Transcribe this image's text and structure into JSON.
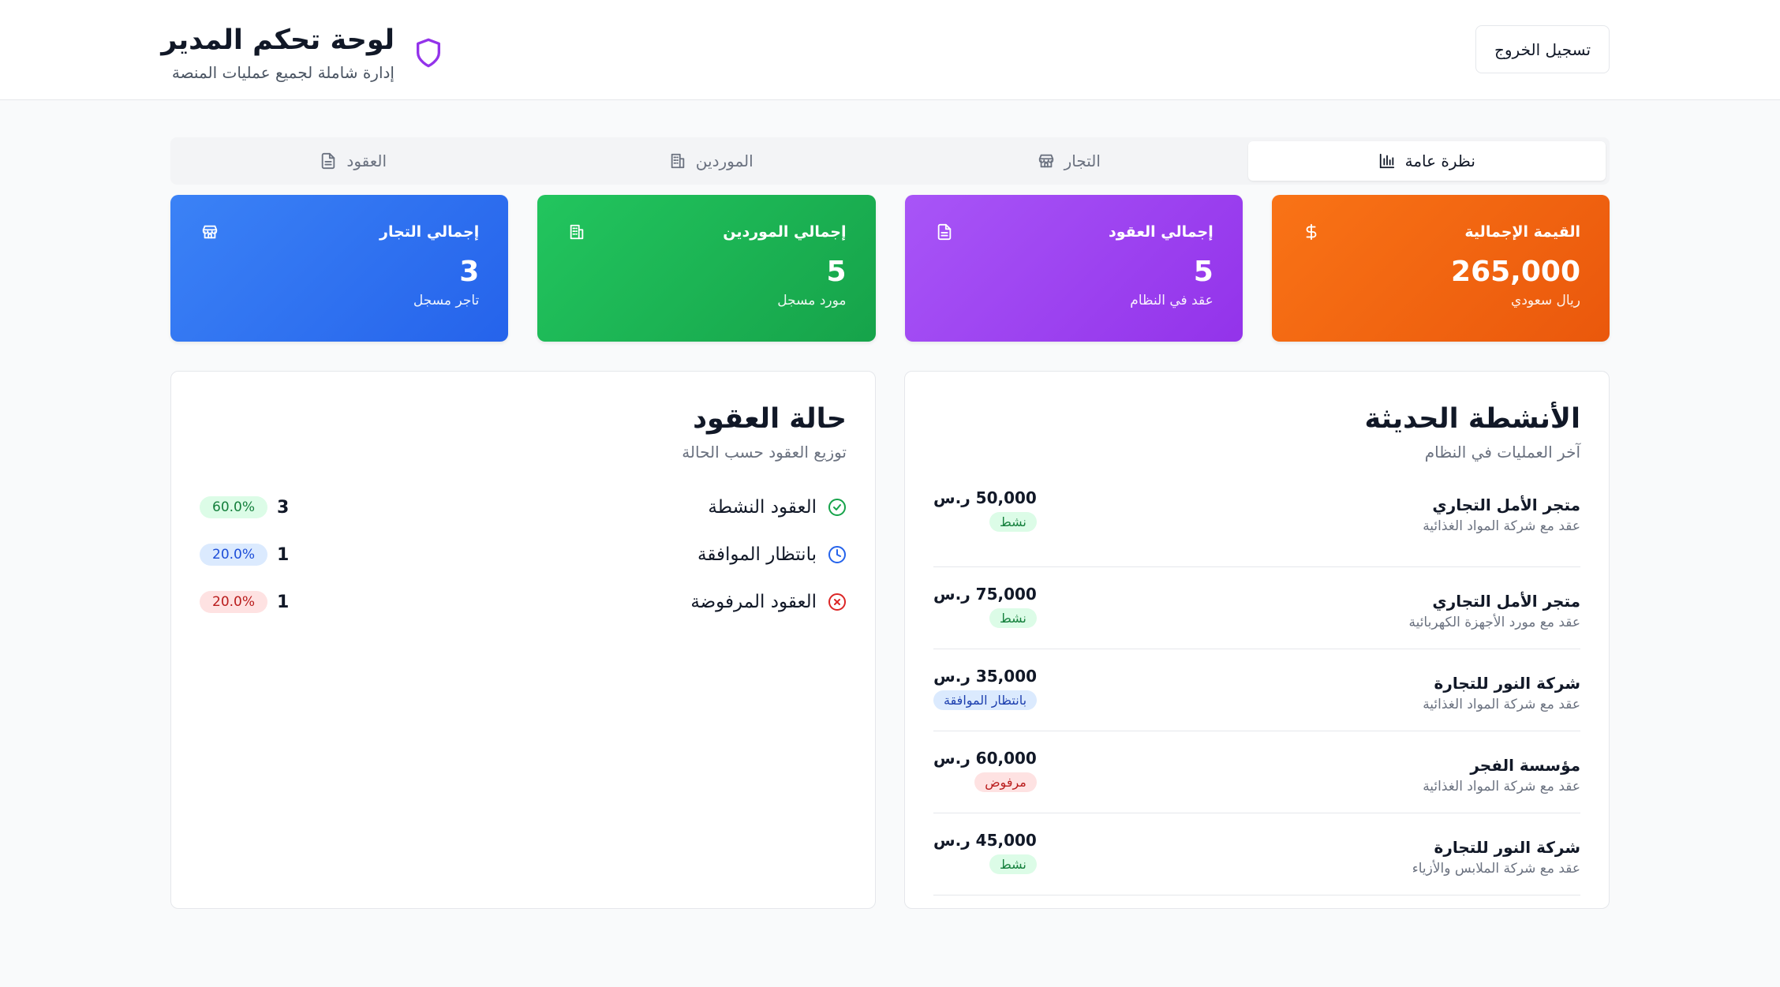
{
  "header": {
    "title": "لوحة تحكم المدير",
    "subtitle": "إدارة شاملة لجميع عمليات المنصة",
    "logout_label": "تسجيل الخروج"
  },
  "tabs": [
    {
      "label": "نظرة عامة",
      "icon": "bar-chart-icon",
      "active": true
    },
    {
      "label": "التجار",
      "icon": "store-icon",
      "active": false
    },
    {
      "label": "الموردين",
      "icon": "building-icon",
      "active": false
    },
    {
      "label": "العقود",
      "icon": "document-icon",
      "active": false
    }
  ],
  "stats": [
    {
      "label": "إجمالي التجار",
      "value": "3",
      "caption": "تاجر مسجل",
      "icon": "store-icon",
      "color": "#3b82f6"
    },
    {
      "label": "إجمالي الموردين",
      "value": "5",
      "caption": "مورد مسجل",
      "icon": "building-icon",
      "color": "#22c55e"
    },
    {
      "label": "إجمالي العقود",
      "value": "5",
      "caption": "عقد في النظام",
      "icon": "document-icon",
      "color": "#a855f7"
    },
    {
      "label": "القيمة الإجمالية",
      "value": "265,000",
      "caption": "ريال سعودي",
      "icon": "dollar-icon",
      "color": "#f97316"
    }
  ],
  "contract_status": {
    "title": "حالة العقود",
    "subtitle": "توزيع العقود حسب الحالة",
    "rows": [
      {
        "label": "العقود النشطة",
        "count": "3",
        "percent": "60.0%",
        "icon": "check-circle-icon"
      },
      {
        "label": "بانتظار الموافقة",
        "count": "1",
        "percent": "20.0%",
        "icon": "clock-icon"
      },
      {
        "label": "العقود المرفوضة",
        "count": "1",
        "percent": "20.0%",
        "icon": "x-circle-icon"
      }
    ]
  },
  "activity": {
    "title": "الأنشطة الحديثة",
    "subtitle": "آخر العمليات في النظام",
    "items": [
      {
        "name": "متجر الأمل التجاري",
        "desc": "عقد مع شركة المواد الغذائية",
        "amount": "50,000 ر.س",
        "status": "نشط"
      },
      {
        "name": "متجر الأمل التجاري",
        "desc": "عقد مع مورد الأجهزة الكهربائية",
        "amount": "75,000 ر.س",
        "status": "نشط"
      },
      {
        "name": "شركة النور للتجارة",
        "desc": "عقد مع شركة المواد الغذائية",
        "amount": "35,000 ر.س",
        "status": "بانتظار الموافقة"
      },
      {
        "name": "مؤسسة الفجر",
        "desc": "عقد مع شركة المواد الغذائية",
        "amount": "60,000 ر.س",
        "status": "مرفوض"
      },
      {
        "name": "شركة النور للتجارة",
        "desc": "عقد مع شركة الملابس والأزياء",
        "amount": "45,000 ر.س",
        "status": "نشط"
      }
    ]
  },
  "colors": {
    "accent_shield": "#9333ea",
    "active_badge": "#15803d",
    "pending_badge": "#1e40af",
    "rejected_badge": "#b91c1c"
  }
}
